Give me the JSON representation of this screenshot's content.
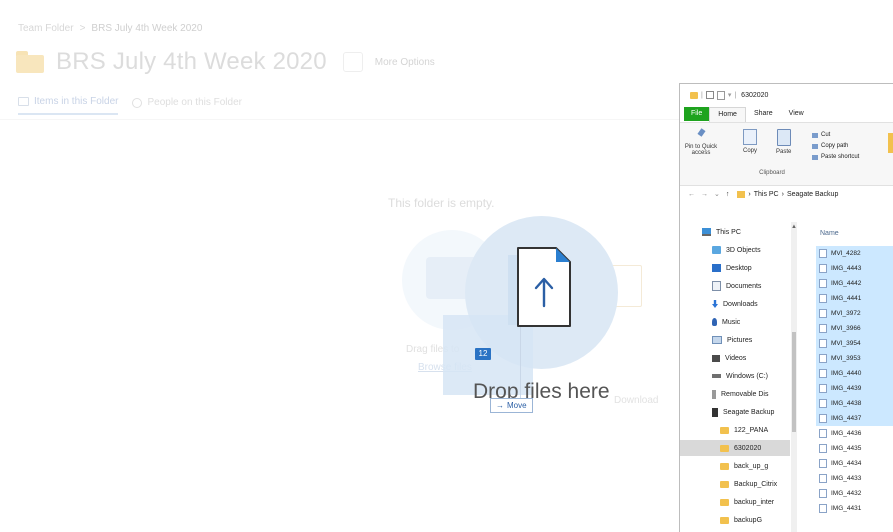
{
  "web": {
    "breadcrumb": [
      "Team Folder",
      ">",
      "BRS July 4th Week 2020"
    ],
    "title": "BRS July 4th Week 2020",
    "more_options": "More Options",
    "tabs": [
      {
        "label": "Items in this Folder",
        "active": true
      },
      {
        "label": "People on this Folder",
        "active": false
      }
    ],
    "empty_text": "This folder is empty.",
    "drag_text": "Drag files to",
    "browse_text": "Browse files",
    "download_text": "Download"
  },
  "drop": {
    "label": "Drop files here",
    "badge": "12",
    "move_tip": "Move",
    "move_arrow": "→"
  },
  "explorer": {
    "title": "6302020",
    "title_sep": "|",
    "title_dropdown": "▾",
    "ribbon_tabs": [
      "File",
      "Home",
      "Share",
      "View"
    ],
    "ribbon_buttons": {
      "pin": "Pin to Quick access",
      "copy": "Copy",
      "paste": "Paste",
      "cut": "Cut",
      "copy_path": "Copy path",
      "paste_shortcut": "Paste shortcut",
      "group": "Clipboard"
    },
    "address": {
      "back": "←",
      "forward": "→",
      "dropdown": "⌄",
      "up": "↑",
      "sep": "›",
      "path": [
        "This PC",
        "›",
        "Seagate Backup"
      ]
    },
    "column_name": "Name",
    "nav": [
      {
        "label": "This PC",
        "icon": "pc"
      },
      {
        "label": "3D Objects",
        "icon": "obj"
      },
      {
        "label": "Desktop",
        "icon": "desk"
      },
      {
        "label": "Documents",
        "icon": "doc"
      },
      {
        "label": "Downloads",
        "icon": "down"
      },
      {
        "label": "Music",
        "icon": "music"
      },
      {
        "label": "Pictures",
        "icon": "pic"
      },
      {
        "label": "Videos",
        "icon": "vid"
      },
      {
        "label": "Windows (C:)",
        "icon": "drive"
      },
      {
        "label": "Removable Dis",
        "icon": "usb"
      },
      {
        "label": "Seagate Backup",
        "icon": "sea"
      },
      {
        "label": "122_PANA",
        "icon": "fold"
      },
      {
        "label": "6302020",
        "icon": "fold",
        "selected": true
      },
      {
        "label": "back_up_g",
        "icon": "fold"
      },
      {
        "label": "Backup_Citrix",
        "icon": "fold"
      },
      {
        "label": "backup_inter",
        "icon": "fold"
      },
      {
        "label": "backupG",
        "icon": "fold"
      }
    ],
    "files": [
      {
        "name": "MVI_4282",
        "selected": true
      },
      {
        "name": "IMG_4443",
        "selected": true
      },
      {
        "name": "IMG_4442",
        "selected": true
      },
      {
        "name": "IMG_4441",
        "selected": true
      },
      {
        "name": "MVI_3972",
        "selected": true
      },
      {
        "name": "MVI_3966",
        "selected": true
      },
      {
        "name": "MVI_3954",
        "selected": true
      },
      {
        "name": "MVI_3953",
        "selected": true
      },
      {
        "name": "IMG_4440",
        "selected": true
      },
      {
        "name": "IMG_4439",
        "selected": true
      },
      {
        "name": "IMG_4438",
        "selected": true
      },
      {
        "name": "IMG_4437",
        "selected": true
      },
      {
        "name": "IMG_4436",
        "selected": false
      },
      {
        "name": "IMG_4435",
        "selected": false
      },
      {
        "name": "IMG_4434",
        "selected": false
      },
      {
        "name": "IMG_4433",
        "selected": false
      },
      {
        "name": "IMG_4432",
        "selected": false
      },
      {
        "name": "IMG_4431",
        "selected": false
      }
    ]
  }
}
